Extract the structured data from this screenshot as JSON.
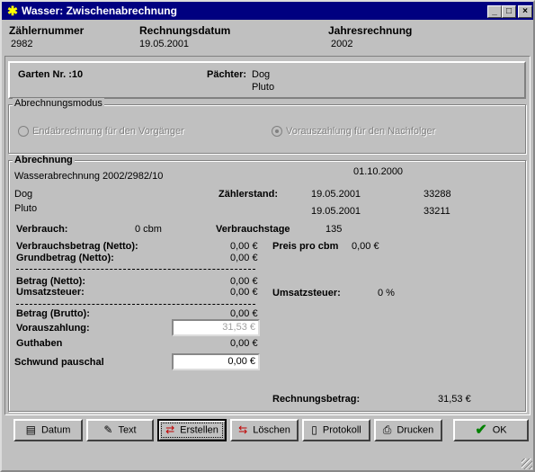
{
  "window": {
    "title": "Wasser: Zwischenabrechnung"
  },
  "header": {
    "meter_label": "Zählernummer",
    "meter_value": "2982",
    "invoice_date_label": "Rechnungsdatum",
    "invoice_date_value": "19.05.2001",
    "year_label": "Jahresrechnung",
    "year_value": "2002"
  },
  "garden": {
    "label": "Garten Nr. :10",
    "tenant_label": "Pächter:",
    "tenant_line1": "Dog",
    "tenant_line2": "Pluto"
  },
  "mode": {
    "legend": "Abrechnungsmodus",
    "option_final": "Endabrechnung für den Vorgänger",
    "option_prepay": "Vorauszahlung für den Nachfolger"
  },
  "billing": {
    "legend": "Abrechnung",
    "title": "Wasserabrechnung 2002/2982/10",
    "date": "01.10.2000",
    "name1": "Dog",
    "name2": "Pluto",
    "meter_label": "Zählerstand:",
    "reading1_date": "19.05.2001",
    "reading1_value": "33288",
    "reading2_date": "19.05.2001",
    "reading2_value": "33211",
    "consumption_label": "Verbrauch:",
    "consumption_value": "0 cbm",
    "days_label": "Verbrauchstage",
    "days_value": "135",
    "amount_net_label": "Verbrauchsbetrag (Netto):",
    "amount_net_value": "0,00 €",
    "base_net_label": "Grundbetrag (Netto):",
    "base_net_value": "0,00 €",
    "price_label": "Preis pro cbm",
    "price_value": "0,00 €",
    "total_net_label": "Betrag (Netto):",
    "total_net_value": "0,00 €",
    "vat_label": "Umsatzsteuer:",
    "vat_value": "0,00 €",
    "vat_rate_label": "Umsatzsteuer:",
    "vat_rate_value": "0 %",
    "gross_label": "Betrag (Brutto):",
    "gross_value": "0,00 €",
    "prepay_label": "Vorauszahlung:",
    "prepay_value": "31,53 €",
    "credit_label": "Guthaben",
    "credit_value": "0,00 €",
    "shrink_label": "Schwund pauschal",
    "shrink_value": "0,00 €",
    "invoice_amount_label": "Rechnungsbetrag:",
    "invoice_amount_value": "31,53 €"
  },
  "buttons": {
    "date": "Datum",
    "text": "Text",
    "create": "Erstellen",
    "delete": "Löschen",
    "log": "Protokoll",
    "print": "Drucken",
    "ok": "OK"
  },
  "colors": {
    "titlebar": "#000080",
    "face": "#c0c0c0",
    "ok_check": "#008000"
  }
}
